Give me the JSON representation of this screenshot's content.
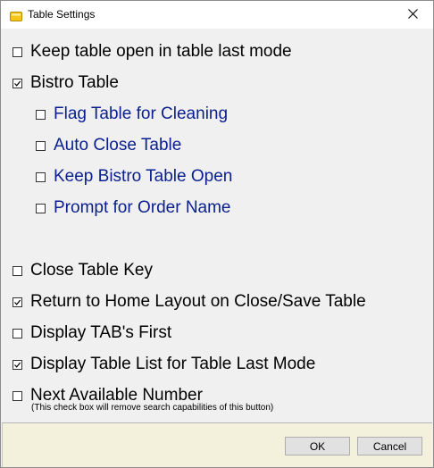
{
  "window": {
    "title": "Table Settings",
    "icon": "table-icon",
    "close_icon": "close-icon"
  },
  "options": [
    {
      "label": "Keep table open in table last mode",
      "checked": false
    },
    {
      "label": "Bistro Table",
      "checked": true
    },
    {
      "label": "Flag Table for Cleaning",
      "checked": false,
      "sub": true
    },
    {
      "label": "Auto Close Table",
      "checked": false,
      "sub": true
    },
    {
      "label": "Keep Bistro Table Open",
      "checked": false,
      "sub": true
    },
    {
      "label": "Prompt for Order Name",
      "checked": false,
      "sub": true
    },
    {
      "label": "Close Table Key",
      "checked": false
    },
    {
      "label": "Return to Home Layout on Close/Save Table",
      "checked": true
    },
    {
      "label": "Display TAB's First",
      "checked": false
    },
    {
      "label": "Display Table List for Table Last Mode",
      "checked": true
    },
    {
      "label": "Next Available Number",
      "checked": false
    }
  ],
  "note": "(This check box will remove search capabilities of this button)",
  "buttons": {
    "ok": "OK",
    "cancel": "Cancel"
  },
  "colors": {
    "sub_label": "#0a1f8f",
    "footer_bg": "#f3f1dc"
  }
}
